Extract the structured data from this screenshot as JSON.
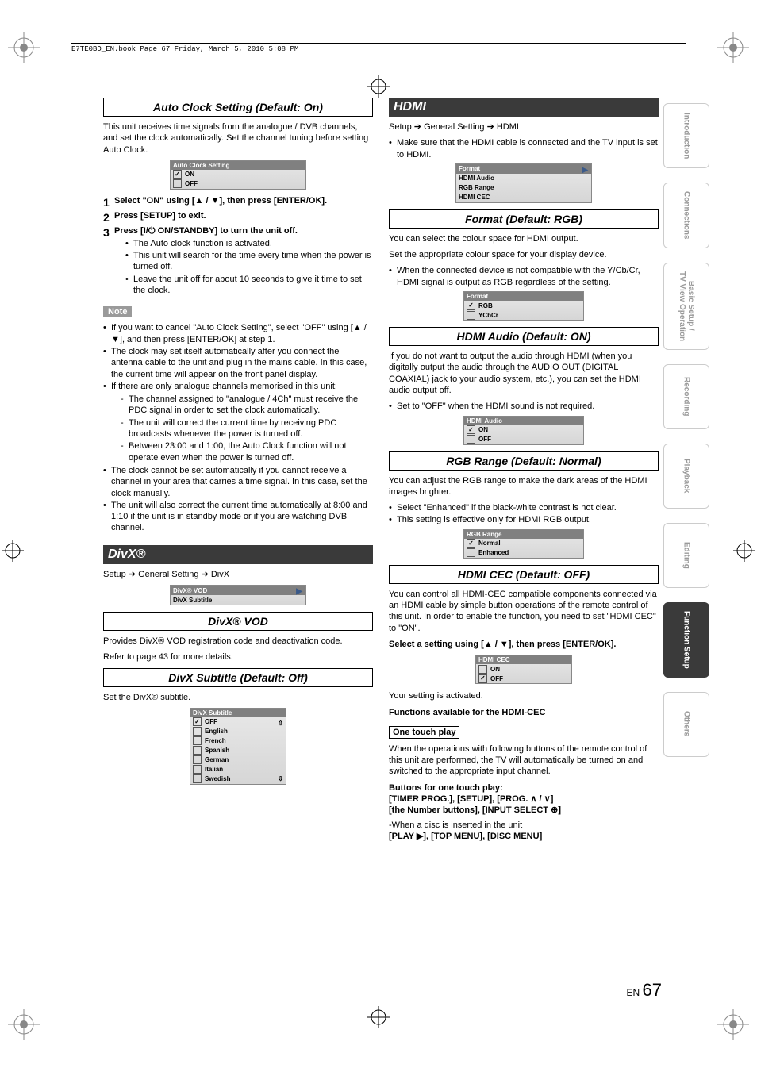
{
  "header": "E7TE0BD_EN.book  Page 67  Friday, March 5, 2010  5:08 PM",
  "page": {
    "lang": "EN",
    "num": "67"
  },
  "tabs": [
    "Introduction",
    "Connections",
    "Basic Setup /\nTV View Operation",
    "Recording",
    "Playback",
    "Editing",
    "Function Setup",
    "Others"
  ],
  "active_tab_index": 6,
  "left": {
    "autoClock": {
      "title": "Auto Clock Setting (Default: On)",
      "intro": "This unit receives time signals from the analogue / DVB channels, and set the clock automatically. Set the channel tuning before setting Auto Clock.",
      "osd_title": "Auto Clock Setting",
      "osd_opts": [
        "ON",
        "OFF"
      ],
      "step1_a": "Select \"ON\" using [",
      "step1_b": "], then press [ENTER/OK].",
      "step2": "Press [SETUP] to exit.",
      "step3_a": "Press [",
      "step3_b": " ON/STANDBY] to turn the unit off.",
      "step3_bul": [
        "The Auto clock function is activated.",
        "This unit will search for the time every time when the power is turned off.",
        "Leave the unit off for about 10 seconds to give it time to set the clock."
      ],
      "note_label": "Note",
      "notes": [
        "If you want to cancel \"Auto Clock Setting\", select \"OFF\" using [▲ / ▼], and then press [ENTER/OK] at step 1.",
        "The clock may set itself automatically after you connect the antenna cable to the unit and plug in the mains cable. In this case, the current time will appear on the front panel display.",
        "If there are only analogue channels memorised in this unit:"
      ],
      "notes_dash": [
        "The channel assigned to \"analogue / 4Ch\" must receive the PDC signal in order to set the clock automatically.",
        "The unit will correct the current time by receiving PDC broadcasts whenever the power is turned off.",
        "Between 23:00 and 1:00, the Auto Clock function will not operate even when the power is turned off."
      ],
      "notes_after": [
        "The clock cannot be set automatically if you cannot receive a channel in your area that carries a time signal. In this case, set the clock manually.",
        "The unit will also correct the current time automatically at 8:00 and 1:10 if the unit is in standby mode or if you are watching DVB channel."
      ]
    },
    "divx": {
      "bar": "DivX®",
      "path": "Setup ➔ General Setting ➔ DivX",
      "osd_opts": [
        "DivX® VOD",
        "DivX Subtitle"
      ],
      "vod_title": "DivX® VOD",
      "vod_p1": "Provides DivX® VOD registration code and deactivation code.",
      "vod_p2": "Refer to page 43 for more details.",
      "sub_title": "DivX Subtitle (Default: Off)",
      "sub_p": "Set the DivX® subtitle.",
      "sub_osd_title": "DivX Subtitle",
      "sub_opts": [
        "OFF",
        "English",
        "French",
        "Spanish",
        "German",
        "Italian",
        "Swedish"
      ]
    }
  },
  "right": {
    "hdmi_bar": "HDMI",
    "hdmi_path": "Setup ➔ General Setting ➔ HDMI",
    "hdmi_intro": "Make sure that the HDMI cable is connected and the TV input is set to HDMI.",
    "hdmi_osd_opts": [
      "Format",
      "HDMI Audio",
      "RGB Range",
      "HDMI CEC"
    ],
    "format": {
      "title": "Format (Default: RGB)",
      "p1": "You can select the colour space for HDMI output.",
      "p2": "Set the appropriate colour space for your display device.",
      "bul": [
        "When the connected device is not compatible with the Y/Cb/Cr, HDMI signal is output as RGB regardless of the setting."
      ],
      "osd_title": "Format",
      "osd_opts": [
        "RGB",
        "YCbCr"
      ]
    },
    "audio": {
      "title": "HDMI Audio (Default: ON)",
      "p": "If you do not want to output the audio through HDMI (when you digitally output the audio through the AUDIO OUT (DIGITAL COAXIAL) jack to your audio system, etc.), you can set the HDMI audio output off.",
      "bul": [
        "Set to \"OFF\" when the HDMI sound is not required."
      ],
      "osd_title": "HDMI Audio",
      "osd_opts": [
        "ON",
        "OFF"
      ]
    },
    "rgb": {
      "title": "RGB Range (Default: Normal)",
      "p": "You can adjust the RGB range to make the dark areas of the HDMI images brighter.",
      "bul": [
        "Select \"Enhanced\" if the black-white contrast is not clear.",
        "This setting is effective only for HDMI RGB output."
      ],
      "osd_title": "RGB Range",
      "osd_opts": [
        "Normal",
        "Enhanced"
      ]
    },
    "cec": {
      "title": "HDMI CEC (Default: OFF)",
      "p": "You can control all HDMI-CEC compatible components connected via an HDMI cable by simple button operations of the remote control of this unit. In order to enable the function, you need to set \"HDMI CEC\" to \"ON\".",
      "step_a": "Select a setting using [",
      "step_b": "], then press [ENTER/OK].",
      "osd_title": "HDMI CEC",
      "osd_opts": [
        "ON",
        "OFF"
      ],
      "activated": "Your setting is activated.",
      "func_heading": "Functions available for the HDMI-CEC",
      "one_touch": "One touch play",
      "one_touch_p": "When the operations with following buttons of the remote control of this unit are performed, the TV will automatically be turned on and switched to the appropriate input channel.",
      "buttons_label": "Buttons for one touch play:",
      "buttons_line1_a": "[TIMER PROG.], [SETUP], [PROG. ",
      "buttons_line1_b": "]",
      "buttons_line2": "[the Number buttons], [INPUT SELECT ⊕]",
      "disc_line": "-When a disc is inserted in the unit",
      "disc_buttons": "[PLAY ▶], [TOP MENU], [DISC MENU]"
    }
  }
}
